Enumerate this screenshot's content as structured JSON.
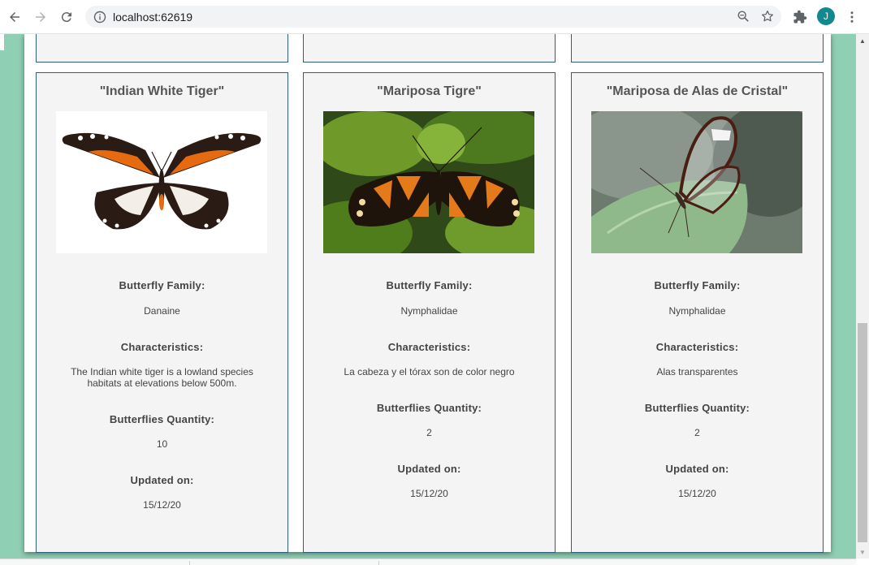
{
  "browser": {
    "url": "localhost:62619",
    "avatar_initial": "J"
  },
  "cards": [
    {
      "title": "\"Indian White Tiger\"",
      "family_label": "Butterfly Family:",
      "family": "Danaine",
      "characteristics_label": "Characteristics:",
      "characteristics": "The Indian white tiger is a lowland species habitats at elevations below 500m.",
      "quantity_label": "Butterflies Quantity:",
      "quantity": "10",
      "updated_label": "Updated on:",
      "updated": "15/12/20",
      "image": "butterfly-photo"
    },
    {
      "title": "\"Mariposa Tigre\"",
      "family_label": "Butterfly Family:",
      "family": "Nymphalidae",
      "characteristics_label": "Characteristics:",
      "characteristics": "La cabeza y el tórax son de color negro",
      "quantity_label": "Butterflies Quantity:",
      "quantity": "2",
      "updated_label": "Updated on:",
      "updated": "15/12/20",
      "image": "butterfly-photo"
    },
    {
      "title": "\"Mariposa de Alas de Cristal\"",
      "family_label": "Butterfly Family:",
      "family": "Nymphalidae",
      "characteristics_label": "Characteristics:",
      "characteristics": "Alas transparentes",
      "quantity_label": "Butterflies Quantity:",
      "quantity": "2",
      "updated_label": "Updated on:",
      "updated": "15/12/20",
      "image": "butterfly-photo"
    }
  ],
  "colors": {
    "page_background": "#8fcfb3",
    "card_border": "#2f5d80",
    "card_background": "#f4f4f4"
  }
}
